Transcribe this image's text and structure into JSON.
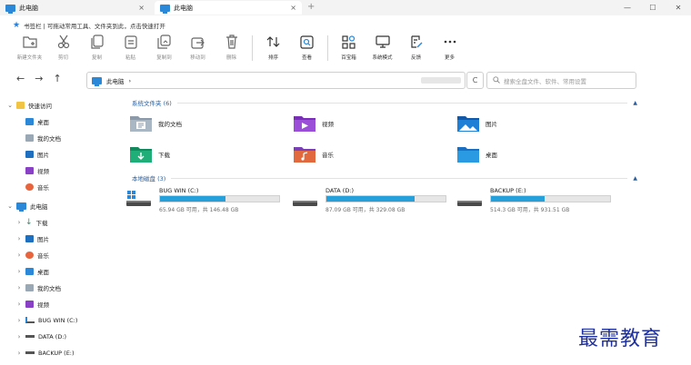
{
  "tabs": [
    {
      "label": "此电脑",
      "close": "×"
    },
    {
      "label": "此电脑",
      "close": "×"
    }
  ],
  "new_tab": "+",
  "window_controls": {
    "minimize": "—",
    "maximize": "☐",
    "close": "✕"
  },
  "bookmark_bar": {
    "text": "书签栏 | 可拖动常用工具、文件夹到此，点击快速打开",
    "icon": "star-icon"
  },
  "toolbar": [
    {
      "label": "新建文件夹",
      "icon": "new-folder-icon",
      "enabled": false
    },
    {
      "label": "剪切",
      "icon": "cut-icon",
      "enabled": false
    },
    {
      "label": "复制",
      "icon": "copy-icon",
      "enabled": false
    },
    {
      "label": "粘贴",
      "icon": "paste-icon",
      "enabled": false
    },
    {
      "label": "复制到",
      "icon": "copy-to-icon",
      "enabled": false
    },
    {
      "label": "移动到",
      "icon": "move-to-icon",
      "enabled": false
    },
    {
      "label": "删除",
      "icon": "delete-icon",
      "enabled": false
    },
    {
      "label": "排序",
      "icon": "sort-icon",
      "enabled": true
    },
    {
      "label": "查看",
      "icon": "view-icon",
      "enabled": true
    },
    {
      "label": "百宝箱",
      "icon": "toolbox-icon",
      "enabled": true
    },
    {
      "label": "系统模式",
      "icon": "system-mode-icon",
      "enabled": true
    },
    {
      "label": "反馈",
      "icon": "feedback-icon",
      "enabled": true
    },
    {
      "label": "更多",
      "icon": "more-icon",
      "enabled": true
    }
  ],
  "nav": {
    "back": "←",
    "forward": "→",
    "up": "↑"
  },
  "address": {
    "location": "此电脑",
    "separator": "›"
  },
  "refresh": "C",
  "search": {
    "placeholder": "搜索全盘文件、软件、常用设置"
  },
  "sidebar": {
    "quick_access": {
      "label": "快速访问",
      "items": [
        "桌面",
        "我的文档",
        "图片",
        "视频",
        "音乐"
      ]
    },
    "this_pc": {
      "label": "此电脑",
      "items": [
        "下载",
        "图片",
        "音乐",
        "桌面",
        "我的文档",
        "视频",
        "BUG WIN (C:)",
        "DATA (D:)",
        "BACKUP (E:)"
      ]
    }
  },
  "system_folders": {
    "header": "系统文件夹 (6)",
    "items": [
      {
        "name": "我的文档",
        "icon": "documents-folder-icon"
      },
      {
        "name": "视频",
        "icon": "videos-folder-icon"
      },
      {
        "name": "图片",
        "icon": "pictures-folder-icon"
      },
      {
        "name": "下载",
        "icon": "downloads-folder-icon"
      },
      {
        "name": "音乐",
        "icon": "music-folder-icon"
      },
      {
        "name": "桌面",
        "icon": "desktop-folder-icon"
      }
    ]
  },
  "local_disks": {
    "header": "本地磁盘 (3)",
    "drives": [
      {
        "name": "BUG WIN (C:)",
        "detail": "65.94 GB 可用，共 146.48 GB",
        "used_fraction": 0.55
      },
      {
        "name": "DATA (D:)",
        "detail": "87.09 GB 可用，共 329.08 GB",
        "used_fraction": 0.74
      },
      {
        "name": "BACKUP (E:)",
        "detail": "514.3 GB 可用，共 931.51 GB",
        "used_fraction": 0.45
      }
    ]
  },
  "watermark": "最需教育",
  "colors": {
    "accent": "#2b88d8",
    "bar": "#26a0da",
    "group_header": "#2a5d9c",
    "watermark": "#1e2f9e"
  }
}
